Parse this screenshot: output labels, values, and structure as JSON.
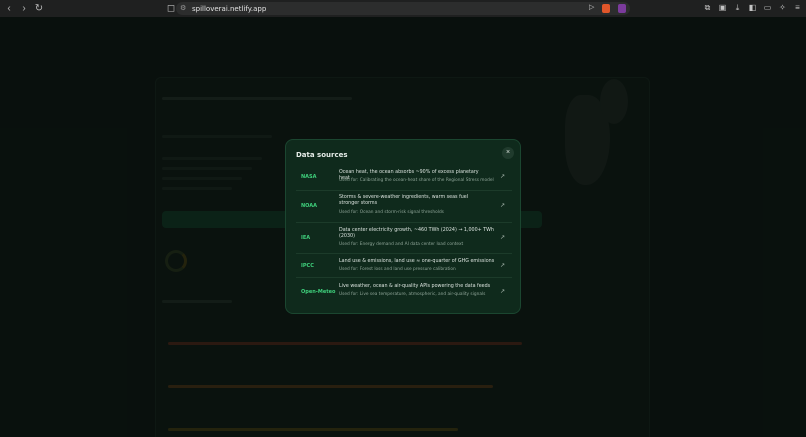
{
  "browser": {
    "url": "spilloverai.netlify.app",
    "back_icon": "arrow-left-icon",
    "forward_icon": "arrow-right-icon",
    "reload_icon": "reload-icon"
  },
  "modal": {
    "title": "Data sources",
    "close_label": "×",
    "rows": [
      {
        "name": "NASA",
        "desc": "Ocean heat, the ocean absorbs ~90% of excess planetary heat",
        "used": "Used for: Calibrating the ocean-heat share of the Regional Stress model",
        "link": "↗"
      },
      {
        "name": "NOAA",
        "desc": "Storms & severe-weather ingredients, warm seas fuel stronger storms",
        "used": "Used for: Ocean and storm-risk signal thresholds",
        "link": "↗"
      },
      {
        "name": "IEA",
        "desc": "Data center electricity growth, ~460 TWh (2024) → 1,000+ TWh (2030)",
        "used": "Used for: Energy demand and AI data center load context",
        "link": "↗"
      },
      {
        "name": "IPCC",
        "desc": "Land use & emissions, land use ≈ one-quarter of GHG emissions",
        "used": "Used for: Forest loss and land use pressure calibration",
        "link": "↗"
      },
      {
        "name": "Open-Meteo",
        "desc": "Live weather, ocean & air-quality APIs powering the data feeds",
        "used": "Used for: Live sea temperature, atmospheric, and air-quality signals",
        "link": "↗"
      }
    ]
  }
}
